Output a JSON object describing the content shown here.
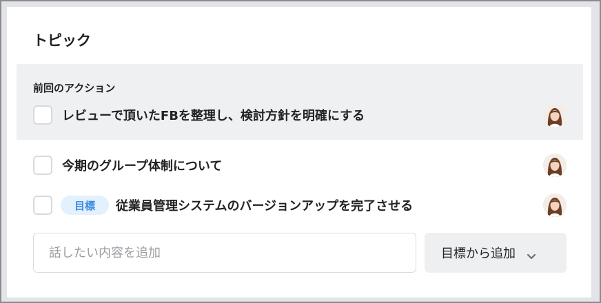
{
  "panel": {
    "title": "トピック"
  },
  "previous_actions": {
    "label": "前回のアクション",
    "items": [
      {
        "text": "レビューで頂いたFBを整理し、検討方針を明確にする",
        "avatar": "woman-avatar"
      }
    ]
  },
  "topics": [
    {
      "text": "今期のグループ体制について",
      "tag": "",
      "avatar": "woman-avatar"
    },
    {
      "text": "従業員管理システムのバージョンアップを完了させる",
      "tag": "目標",
      "avatar": "woman-avatar"
    }
  ],
  "composer": {
    "placeholder": "話したい内容を追加",
    "value": "",
    "add_from_goal_label": "目標から追加",
    "dropdown_icon": "chevron-down-icon"
  },
  "colors": {
    "tag_bg": "#e3f0fd",
    "tag_text": "#3a8be0",
    "prev_block_bg": "#eff0f2"
  }
}
